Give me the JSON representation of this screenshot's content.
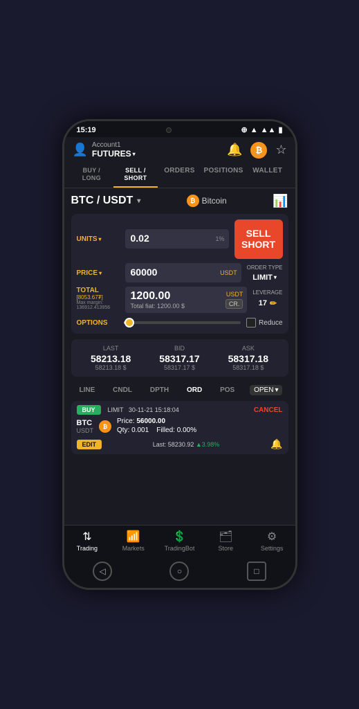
{
  "statusBar": {
    "time": "15:19"
  },
  "header": {
    "accountLabel": "Account1",
    "futuresLabel": "FUTURES",
    "dropdownArrow": "▾"
  },
  "tabs": [
    {
      "id": "buy-long",
      "label": "BUY /\nLONG",
      "active": false
    },
    {
      "id": "sell-short",
      "label": "SELL /\nSHORT",
      "active": true
    },
    {
      "id": "orders",
      "label": "ORDERS",
      "active": false
    },
    {
      "id": "positions",
      "label": "POSITIONS",
      "active": false
    },
    {
      "id": "wallet",
      "label": "WALLET",
      "active": false
    }
  ],
  "pair": {
    "name": "BTC / USDT",
    "coinName": "Bitcoin",
    "coinSymbol": "₿"
  },
  "form": {
    "unitsLabel": "UNITS",
    "unitsValue": "0.02",
    "unitsPct": "1%",
    "priceLabel": "PRICE",
    "priceValue": "60000",
    "priceSuffix": "USDT",
    "totalLabel": "TOTAL",
    "totalBrackets": "[8053.67₮]",
    "maxMarginLabel": "Max margin:",
    "maxMarginValue": "136912.413956",
    "totalValue": "1200.00",
    "totalSuffix": "USDT",
    "totalFiat": "Total fiat: 1200.00 $",
    "sellShortLabel": "SELL\nSHORT",
    "orderTypeLabel": "ORDER TYPE",
    "orderTypeValue": "LIMIT",
    "leverageLabel": "LEVERAGE",
    "leverageValue": "17",
    "optionsLabel": "OPTIONS",
    "reduceLabel": "Reduce"
  },
  "market": {
    "lastLabel": "LAST",
    "lastValue": "58213.18",
    "lastSub": "58213.18 $",
    "bidLabel": "BID",
    "bidValue": "58317.17",
    "bidSub": "58317.17 $",
    "askLabel": "ASK",
    "askValue": "58317.18",
    "askSub": "58317.18 $"
  },
  "chartTabs": [
    "LINE",
    "CNDL",
    "DPTH",
    "ORD",
    "POS"
  ],
  "activeChartTab": "ORD",
  "openLabel": "OPEN",
  "order": {
    "buyBadge": "BUY",
    "orderType": "LIMIT",
    "datetime": "30-11-21 15:18:04",
    "cancelLabel": "CANCEL",
    "pairName": "BTC",
    "pairSub": "USDT",
    "coinSymbol": "₿",
    "priceLabel": "Price:",
    "priceValue": "56000.00",
    "qtyLabel": "Qty:",
    "qtyValue": "0.001",
    "filledLabel": "Filled:",
    "filledValue": "0.00%",
    "editLabel": "EDIT",
    "lastLabel": "Last:",
    "lastValue": "58230.92",
    "changeValue": "▲3.98%"
  },
  "bottomNav": [
    {
      "id": "trading",
      "label": "Trading",
      "icon": "⇅",
      "active": true
    },
    {
      "id": "markets",
      "label": "Markets",
      "icon": "📊",
      "active": false
    },
    {
      "id": "tradingbot",
      "label": "TradingBot",
      "icon": "💲",
      "active": false
    },
    {
      "id": "store",
      "label": "Store",
      "icon": "🗂",
      "active": false
    },
    {
      "id": "settings",
      "label": "Settings",
      "icon": "⚙",
      "active": false
    }
  ],
  "phoneNav": {
    "backIcon": "◁",
    "homeIcon": "○",
    "recentIcon": "□"
  }
}
